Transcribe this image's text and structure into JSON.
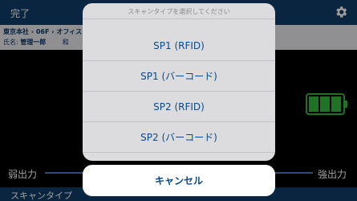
{
  "topbar": {
    "done_label": "完了",
    "icon": "gear-icon"
  },
  "info": {
    "location": "東京本社 › 06F › オフィス",
    "name_prefix": "氏名:",
    "name_value": "管理一郎",
    "truncated_label": "和"
  },
  "battery": {
    "bars_filled": 3,
    "bars_total": 3,
    "color": "#35b83a"
  },
  "power": {
    "weak_label": "弱出力",
    "strong_label": "強出力"
  },
  "bottombar": {
    "label": "スキャンタイプ"
  },
  "sheet": {
    "title": "スキャンタイプを選択してください",
    "options": [
      {
        "label": "SP1 (RFID)"
      },
      {
        "label": "SP1 (バーコード)"
      },
      {
        "label": "SP2 (RFID)"
      },
      {
        "label": "SP2 (バーコード)"
      }
    ],
    "cancel_label": "キャンセル"
  }
}
